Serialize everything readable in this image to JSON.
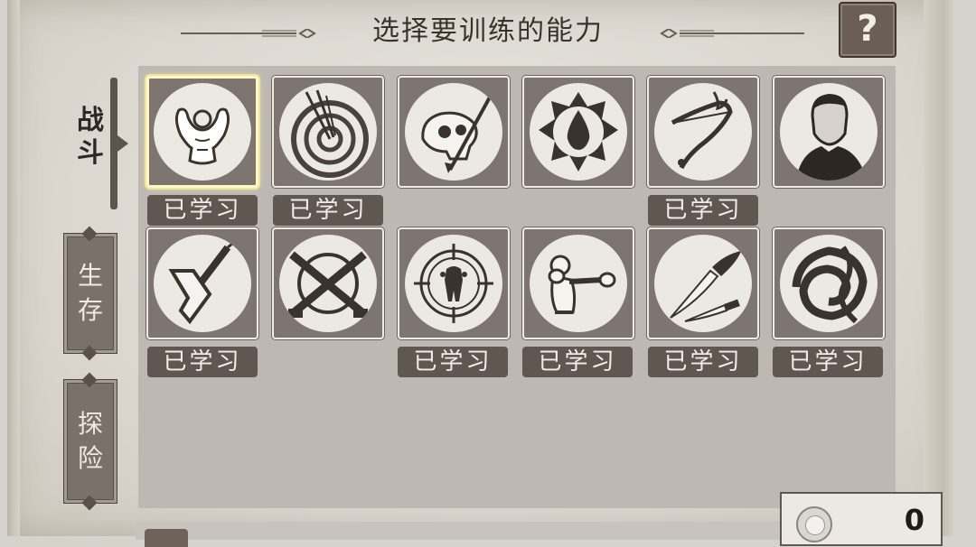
{
  "header": {
    "title": "选择要训练的能力",
    "help_label": "?"
  },
  "tabs": [
    {
      "label": "战斗",
      "active": true
    },
    {
      "label": "生存",
      "active": false
    },
    {
      "label": "探险",
      "active": false
    }
  ],
  "skills": [
    {
      "icon": "strong-man-icon",
      "learned": true,
      "selected": true
    },
    {
      "icon": "arrow-target-icon",
      "learned": true,
      "selected": false
    },
    {
      "icon": "skull-spear-icon",
      "learned": false,
      "selected": false
    },
    {
      "icon": "blood-drop-icon",
      "learned": false,
      "selected": false
    },
    {
      "icon": "bow-icon",
      "learned": true,
      "selected": false
    },
    {
      "icon": "man-portrait-icon",
      "learned": false,
      "selected": false
    },
    {
      "icon": "hatchet-icon",
      "learned": true,
      "selected": false
    },
    {
      "icon": "crossed-rifles-icon",
      "learned": false,
      "selected": false
    },
    {
      "icon": "bear-crosshair-icon",
      "learned": true,
      "selected": false
    },
    {
      "icon": "boxer-icon",
      "learned": true,
      "selected": false
    },
    {
      "icon": "knives-icon",
      "learned": true,
      "selected": false
    },
    {
      "icon": "swirl-icon",
      "learned": true,
      "selected": false
    }
  ],
  "learned_label": "已学习",
  "currency": {
    "value": "0"
  }
}
